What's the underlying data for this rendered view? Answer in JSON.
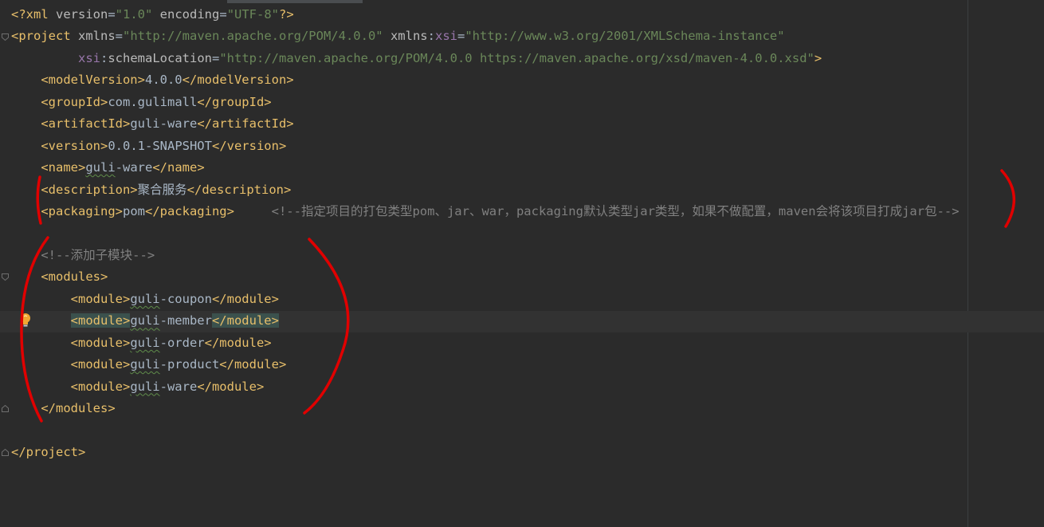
{
  "lines": [
    {
      "id": "l1",
      "parts": [
        [
          "t",
          "<?"
        ],
        [
          "t",
          "xml "
        ],
        [
          "a",
          "version"
        ],
        [
          "txt",
          "="
        ],
        [
          "v",
          "\"1.0\""
        ],
        [
          "a",
          " encoding"
        ],
        [
          "txt",
          "="
        ],
        [
          "v",
          "\"UTF-8\""
        ],
        [
          "t",
          "?>"
        ]
      ]
    },
    {
      "id": "l2",
      "parts": [
        [
          "t",
          "<project "
        ],
        [
          "a",
          "xmlns"
        ],
        [
          "txt",
          "="
        ],
        [
          "v",
          "\"http://maven.apache.org/POM/4.0.0\""
        ],
        [
          "a",
          " xmlns"
        ],
        [
          "txt",
          ":"
        ],
        [
          "ns",
          "xsi"
        ],
        [
          "txt",
          "="
        ],
        [
          "v",
          "\"http://www.w3.org/2001/XMLSchema-instance\""
        ]
      ]
    },
    {
      "id": "l3",
      "parts": [
        [
          "txt",
          "         "
        ],
        [
          "ns",
          "xsi"
        ],
        [
          "txt",
          ":"
        ],
        [
          "a",
          "schemaLocation"
        ],
        [
          "txt",
          "="
        ],
        [
          "v",
          "\"http://maven.apache.org/POM/4.0.0 https://maven.apache.org/xsd/maven-4.0.0.xsd\""
        ],
        [
          "t",
          ">"
        ]
      ]
    },
    {
      "id": "l4",
      "parts": [
        [
          "txt",
          "    "
        ],
        [
          "t",
          "<modelVersion>"
        ],
        [
          "txt",
          "4.0.0"
        ],
        [
          "t",
          "</modelVersion>"
        ]
      ]
    },
    {
      "id": "l5",
      "parts": [
        [
          "txt",
          "    "
        ],
        [
          "t",
          "<groupId>"
        ],
        [
          "txt",
          "com.gulimall"
        ],
        [
          "t",
          "</groupId>"
        ]
      ]
    },
    {
      "id": "l6",
      "parts": [
        [
          "txt",
          "    "
        ],
        [
          "t",
          "<artifactId>"
        ],
        [
          "txt",
          "guli-ware"
        ],
        [
          "t",
          "</artifactId>"
        ]
      ]
    },
    {
      "id": "l7",
      "parts": [
        [
          "txt",
          "    "
        ],
        [
          "t",
          "<version>"
        ],
        [
          "txt",
          "0.0.1-SNAPSHOT"
        ],
        [
          "t",
          "</version>"
        ]
      ]
    },
    {
      "id": "l8",
      "parts": [
        [
          "txt",
          "    "
        ],
        [
          "t",
          "<name>"
        ],
        [
          "sq",
          "guli"
        ],
        [
          "txt",
          "-ware"
        ],
        [
          "t",
          "</name>"
        ]
      ]
    },
    {
      "id": "l9",
      "parts": [
        [
          "txt",
          "    "
        ],
        [
          "t",
          "<description>"
        ],
        [
          "txt",
          "聚合服务"
        ],
        [
          "t",
          "</description>"
        ]
      ]
    },
    {
      "id": "l10",
      "parts": [
        [
          "txt",
          "    "
        ],
        [
          "t",
          "<packaging>"
        ],
        [
          "txt",
          "pom"
        ],
        [
          "t",
          "</packaging>"
        ],
        [
          "txt",
          "     "
        ],
        [
          "c",
          "<!--指定项目的打包类型pom、jar、war，packaging默认类型jar类型，如果不做配置，maven会将该项目打成jar包-->"
        ]
      ]
    },
    {
      "id": "l11",
      "parts": []
    },
    {
      "id": "l12",
      "parts": [
        [
          "txt",
          "    "
        ],
        [
          "c",
          "<!--添加子模块-->"
        ]
      ]
    },
    {
      "id": "l13",
      "parts": [
        [
          "txt",
          "    "
        ],
        [
          "t",
          "<modules>"
        ]
      ]
    },
    {
      "id": "l14",
      "parts": [
        [
          "txt",
          "        "
        ],
        [
          "t",
          "<module>"
        ],
        [
          "sq",
          "guli"
        ],
        [
          "txt",
          "-coupon"
        ],
        [
          "t",
          "</module>"
        ]
      ]
    },
    {
      "id": "l15",
      "parts": [
        [
          "txt",
          "        "
        ],
        [
          "th",
          "<module>"
        ],
        [
          "sq",
          "guli"
        ],
        [
          "txt",
          "-member"
        ],
        [
          "th",
          "</module>"
        ]
      ]
    },
    {
      "id": "l16",
      "parts": [
        [
          "txt",
          "        "
        ],
        [
          "t",
          "<module>"
        ],
        [
          "sq",
          "guli"
        ],
        [
          "txt",
          "-order"
        ],
        [
          "t",
          "</module>"
        ]
      ]
    },
    {
      "id": "l17",
      "parts": [
        [
          "txt",
          "        "
        ],
        [
          "t",
          "<module>"
        ],
        [
          "sq",
          "guli"
        ],
        [
          "txt",
          "-product"
        ],
        [
          "t",
          "</module>"
        ]
      ]
    },
    {
      "id": "l18",
      "parts": [
        [
          "txt",
          "        "
        ],
        [
          "t",
          "<module>"
        ],
        [
          "sq",
          "guli"
        ],
        [
          "txt",
          "-ware"
        ],
        [
          "t",
          "</module>"
        ]
      ]
    },
    {
      "id": "l19",
      "parts": [
        [
          "txt",
          "    "
        ],
        [
          "t",
          "</modules>"
        ]
      ]
    },
    {
      "id": "l20",
      "parts": []
    },
    {
      "id": "l21",
      "parts": [
        [
          "t",
          "</project>"
        ]
      ]
    }
  ],
  "gutter": {
    "fold_icons": [
      "fold-open",
      "fold-open",
      "fold-close",
      "fold-open",
      "fold-close"
    ],
    "intention_icon": "lightbulb-icon"
  },
  "colors": {
    "background": "#2b2b2b",
    "tag": "#e8bf6a",
    "attribute": "#bababa",
    "value": "#6a8759",
    "namespace": "#9876aa",
    "comment": "#808080",
    "text": "#a9b7c6",
    "annotation_marker": "#e00000"
  }
}
